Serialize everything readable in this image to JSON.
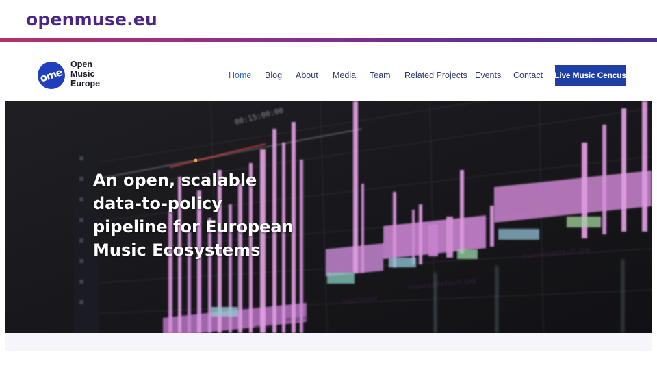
{
  "slide": {
    "title": "openmuse.eu"
  },
  "site": {
    "logo_mark": "ome",
    "logo_lines": [
      "Open",
      "Music",
      "Europe"
    ],
    "nav": [
      {
        "label": "Home",
        "active": true
      },
      {
        "label": "Blog",
        "active": false
      },
      {
        "label": "About",
        "active": false
      },
      {
        "label": "Media",
        "active": false
      },
      {
        "label": "Team",
        "active": false
      },
      {
        "label": "Related Projects",
        "active": false
      },
      {
        "label": "Events",
        "active": false
      },
      {
        "label": "Contact",
        "active": false
      }
    ],
    "cta_label": "Live Music Cencus"
  },
  "hero": {
    "headline_lines": [
      "An open, scalable",
      "data-to-policy",
      "pipeline for European",
      "Music Ecosystems"
    ],
    "image_text": {
      "timecode": "00:15:00:00",
      "clip_labels": [
        "maxresde",
        "maxresdefault.jpg",
        "maxresdefault.jpg",
        "maxre",
        "maxi"
      ]
    }
  },
  "colors": {
    "brand_purple": "#4b2585",
    "rule_gradient": [
      "#b4306a",
      "#4b2d90"
    ],
    "cta_blue": "#1d3fa6",
    "nav_active": "#2a69c8",
    "clip_pink": "#d98ee0"
  }
}
